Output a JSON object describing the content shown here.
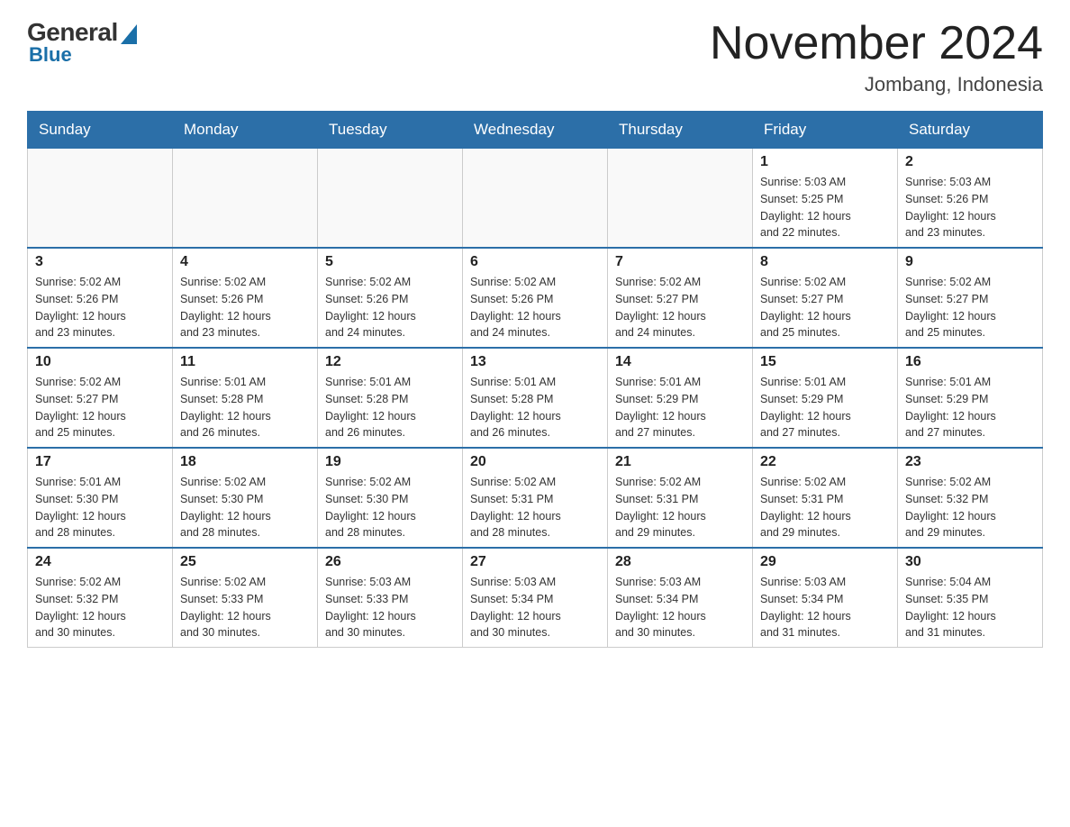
{
  "header": {
    "logo": {
      "general_text": "General",
      "blue_text": "Blue"
    },
    "title": "November 2024",
    "subtitle": "Jombang, Indonesia"
  },
  "weekdays": [
    "Sunday",
    "Monday",
    "Tuesday",
    "Wednesday",
    "Thursday",
    "Friday",
    "Saturday"
  ],
  "weeks": [
    [
      {
        "day": "",
        "info": ""
      },
      {
        "day": "",
        "info": ""
      },
      {
        "day": "",
        "info": ""
      },
      {
        "day": "",
        "info": ""
      },
      {
        "day": "",
        "info": ""
      },
      {
        "day": "1",
        "info": "Sunrise: 5:03 AM\nSunset: 5:25 PM\nDaylight: 12 hours\nand 22 minutes."
      },
      {
        "day": "2",
        "info": "Sunrise: 5:03 AM\nSunset: 5:26 PM\nDaylight: 12 hours\nand 23 minutes."
      }
    ],
    [
      {
        "day": "3",
        "info": "Sunrise: 5:02 AM\nSunset: 5:26 PM\nDaylight: 12 hours\nand 23 minutes."
      },
      {
        "day": "4",
        "info": "Sunrise: 5:02 AM\nSunset: 5:26 PM\nDaylight: 12 hours\nand 23 minutes."
      },
      {
        "day": "5",
        "info": "Sunrise: 5:02 AM\nSunset: 5:26 PM\nDaylight: 12 hours\nand 24 minutes."
      },
      {
        "day": "6",
        "info": "Sunrise: 5:02 AM\nSunset: 5:26 PM\nDaylight: 12 hours\nand 24 minutes."
      },
      {
        "day": "7",
        "info": "Sunrise: 5:02 AM\nSunset: 5:27 PM\nDaylight: 12 hours\nand 24 minutes."
      },
      {
        "day": "8",
        "info": "Sunrise: 5:02 AM\nSunset: 5:27 PM\nDaylight: 12 hours\nand 25 minutes."
      },
      {
        "day": "9",
        "info": "Sunrise: 5:02 AM\nSunset: 5:27 PM\nDaylight: 12 hours\nand 25 minutes."
      }
    ],
    [
      {
        "day": "10",
        "info": "Sunrise: 5:02 AM\nSunset: 5:27 PM\nDaylight: 12 hours\nand 25 minutes."
      },
      {
        "day": "11",
        "info": "Sunrise: 5:01 AM\nSunset: 5:28 PM\nDaylight: 12 hours\nand 26 minutes."
      },
      {
        "day": "12",
        "info": "Sunrise: 5:01 AM\nSunset: 5:28 PM\nDaylight: 12 hours\nand 26 minutes."
      },
      {
        "day": "13",
        "info": "Sunrise: 5:01 AM\nSunset: 5:28 PM\nDaylight: 12 hours\nand 26 minutes."
      },
      {
        "day": "14",
        "info": "Sunrise: 5:01 AM\nSunset: 5:29 PM\nDaylight: 12 hours\nand 27 minutes."
      },
      {
        "day": "15",
        "info": "Sunrise: 5:01 AM\nSunset: 5:29 PM\nDaylight: 12 hours\nand 27 minutes."
      },
      {
        "day": "16",
        "info": "Sunrise: 5:01 AM\nSunset: 5:29 PM\nDaylight: 12 hours\nand 27 minutes."
      }
    ],
    [
      {
        "day": "17",
        "info": "Sunrise: 5:01 AM\nSunset: 5:30 PM\nDaylight: 12 hours\nand 28 minutes."
      },
      {
        "day": "18",
        "info": "Sunrise: 5:02 AM\nSunset: 5:30 PM\nDaylight: 12 hours\nand 28 minutes."
      },
      {
        "day": "19",
        "info": "Sunrise: 5:02 AM\nSunset: 5:30 PM\nDaylight: 12 hours\nand 28 minutes."
      },
      {
        "day": "20",
        "info": "Sunrise: 5:02 AM\nSunset: 5:31 PM\nDaylight: 12 hours\nand 28 minutes."
      },
      {
        "day": "21",
        "info": "Sunrise: 5:02 AM\nSunset: 5:31 PM\nDaylight: 12 hours\nand 29 minutes."
      },
      {
        "day": "22",
        "info": "Sunrise: 5:02 AM\nSunset: 5:31 PM\nDaylight: 12 hours\nand 29 minutes."
      },
      {
        "day": "23",
        "info": "Sunrise: 5:02 AM\nSunset: 5:32 PM\nDaylight: 12 hours\nand 29 minutes."
      }
    ],
    [
      {
        "day": "24",
        "info": "Sunrise: 5:02 AM\nSunset: 5:32 PM\nDaylight: 12 hours\nand 30 minutes."
      },
      {
        "day": "25",
        "info": "Sunrise: 5:02 AM\nSunset: 5:33 PM\nDaylight: 12 hours\nand 30 minutes."
      },
      {
        "day": "26",
        "info": "Sunrise: 5:03 AM\nSunset: 5:33 PM\nDaylight: 12 hours\nand 30 minutes."
      },
      {
        "day": "27",
        "info": "Sunrise: 5:03 AM\nSunset: 5:34 PM\nDaylight: 12 hours\nand 30 minutes."
      },
      {
        "day": "28",
        "info": "Sunrise: 5:03 AM\nSunset: 5:34 PM\nDaylight: 12 hours\nand 30 minutes."
      },
      {
        "day": "29",
        "info": "Sunrise: 5:03 AM\nSunset: 5:34 PM\nDaylight: 12 hours\nand 31 minutes."
      },
      {
        "day": "30",
        "info": "Sunrise: 5:04 AM\nSunset: 5:35 PM\nDaylight: 12 hours\nand 31 minutes."
      }
    ]
  ]
}
